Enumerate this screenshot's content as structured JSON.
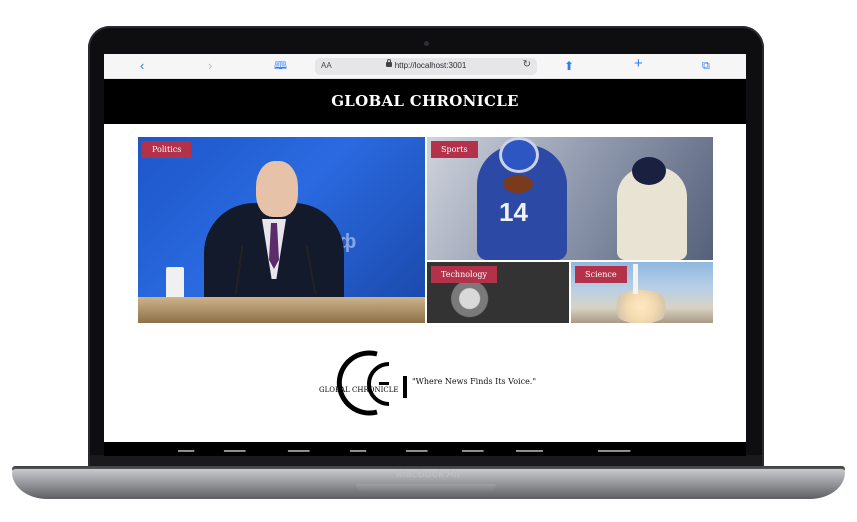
{
  "device": {
    "label": "MacBook Air"
  },
  "browser": {
    "url": "http://localhost:3001",
    "text_size_label": "AA"
  },
  "site": {
    "title": "GLOBAL CHRONICLE",
    "tagline": "\"Where News Finds Its Voice.\"",
    "logo_text": "GLOBAL CHRONICLE",
    "logo_letters": "GC"
  },
  "hero": {
    "tiles": [
      {
        "category": "Politics"
      },
      {
        "category": "Sports"
      },
      {
        "category": "Technology"
      },
      {
        "category": "Science"
      }
    ],
    "politics_background_text": "П          т.рф",
    "sports_jersey_number": "14"
  },
  "colors": {
    "header_bg": "#000000",
    "tag_bg": "#b3324a",
    "browser_accent": "#2f7cf6"
  },
  "icons": [
    "back-icon",
    "forward-icon",
    "bookmarks-icon",
    "lock-icon",
    "reload-icon",
    "share-icon",
    "new-tab-icon",
    "tabs-icon"
  ]
}
